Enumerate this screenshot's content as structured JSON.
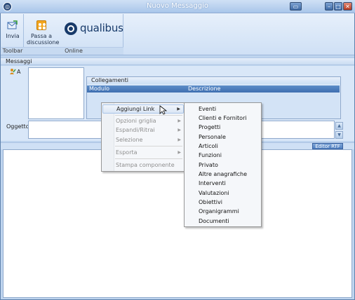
{
  "window": {
    "title": "Nuovo Messaggio",
    "app_icon": "app-logo-icon"
  },
  "ribbon": {
    "groups": [
      {
        "label": "Toolbar"
      },
      {
        "label": "Online"
      }
    ],
    "buttons": {
      "invia": {
        "label": "Invia",
        "icon": "send-icon"
      },
      "passa": {
        "label": "Passa a discussione",
        "icon": "discussion-icon"
      }
    },
    "logo_text": "qualibus"
  },
  "messaggi_label": "Messaggi",
  "form": {
    "to_label": "A",
    "collegamenti": {
      "title": "Collegamenti",
      "columns": [
        "Modulo",
        "Descrizione"
      ]
    },
    "oggetto_label": "Oggetto:",
    "oggetto_value": "",
    "editor_button": "Editor RTF"
  },
  "context_menu": {
    "items": [
      {
        "label": "Aggiungi Link",
        "disabled": false,
        "submenu": true
      },
      {
        "label": "Opzioni griglia",
        "disabled": true,
        "submenu": true
      },
      {
        "label": "Espandi/Ritrai",
        "disabled": true,
        "submenu": true
      },
      {
        "label": "Selezione",
        "disabled": true,
        "submenu": true
      },
      {
        "label": "Esporta",
        "disabled": true,
        "submenu": true
      },
      {
        "label": "Stampa componente",
        "disabled": true,
        "submenu": false
      }
    ],
    "arrow_glyph": "▶"
  },
  "submenu": {
    "items": [
      "Eventi",
      "Clienti e Fornitori",
      "Progetti",
      "Personale",
      "Articoli",
      "Funzioni",
      "Privato",
      "Altre anagrafiche",
      "Interventi",
      "Valutazioni",
      "Obiettivi",
      "Organigrammi",
      "Documenti"
    ]
  },
  "colors": {
    "ribbon_bg": "#cfe0f5",
    "header_blue": "#3f6fb0",
    "accent_orange": "#f2a51d"
  }
}
